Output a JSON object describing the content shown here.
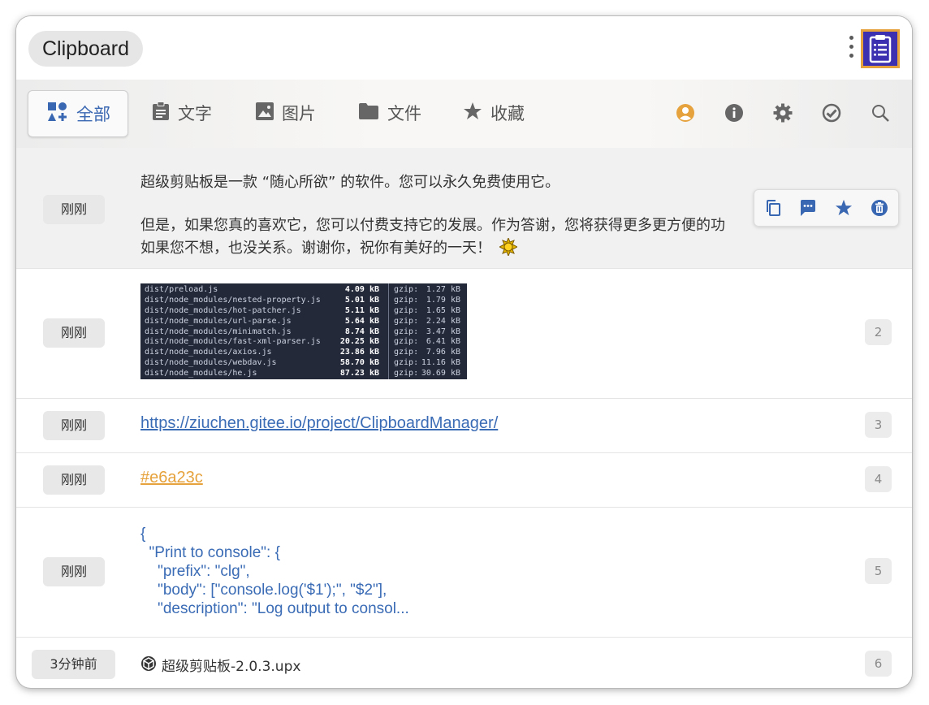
{
  "app": {
    "title": "Clipboard"
  },
  "colors": {
    "accent": "#3a67b1",
    "user_orange": "#e6a23c",
    "link_blue": "#3a6bb5"
  },
  "tabs": [
    {
      "label": "全部",
      "icon": "all-categories-icon",
      "active": true
    },
    {
      "label": "文字",
      "icon": "clipboard-text-icon",
      "active": false
    },
    {
      "label": "图片",
      "icon": "image-icon",
      "active": false
    },
    {
      "label": "文件",
      "icon": "folder-icon",
      "active": false
    },
    {
      "label": "收藏",
      "icon": "star-icon",
      "active": false
    }
  ],
  "toolbar_icons": [
    "user-icon",
    "info-icon",
    "gear-icon",
    "check-badge-icon",
    "search-icon"
  ],
  "hover_actions": [
    "copy-icon",
    "comment-icon",
    "star-icon",
    "delete-icon"
  ],
  "items": [
    {
      "time": "刚刚",
      "type": "text",
      "lines": [
        "超级剪贴板是一款 “随心所欲” 的软件。您可以永久免费使用它。",
        "但是，如果您真的喜欢它，您可以付费支持它的发展。作为答谢，您将获得更多更方便的功",
        "如果您不想，也没关系。谢谢你，祝你有美好的一天！"
      ]
    },
    {
      "time": "刚刚",
      "type": "image",
      "number": "2",
      "terminal": [
        {
          "path": "dist/preload.js",
          "size": "4.09 kB",
          "gzip": "gzip:",
          "gsize": "1.27 kB"
        },
        {
          "path": "dist/node_modules/nested-property.js",
          "size": "5.01 kB",
          "gzip": "gzip:",
          "gsize": "1.79 kB"
        },
        {
          "path": "dist/node_modules/hot-patcher.js",
          "size": "5.11 kB",
          "gzip": "gzip:",
          "gsize": "1.65 kB"
        },
        {
          "path": "dist/node_modules/url-parse.js",
          "size": "5.64 kB",
          "gzip": "gzip:",
          "gsize": "2.24 kB"
        },
        {
          "path": "dist/node_modules/minimatch.js",
          "size": "8.74 kB",
          "gzip": "gzip:",
          "gsize": "3.47 kB"
        },
        {
          "path": "dist/node_modules/fast-xml-parser.js",
          "size": "20.25 kB",
          "gzip": "gzip:",
          "gsize": "6.41 kB"
        },
        {
          "path": "dist/node_modules/axios.js",
          "size": "23.86 kB",
          "gzip": "gzip:",
          "gsize": "7.96 kB"
        },
        {
          "path": "dist/node_modules/webdav.js",
          "size": "58.70 kB",
          "gzip": "gzip:",
          "gsize": "11.16 kB"
        },
        {
          "path": "dist/node_modules/he.js",
          "size": "87.23 kB",
          "gzip": "gzip:",
          "gsize": "30.69 kB"
        }
      ]
    },
    {
      "time": "刚刚",
      "type": "link",
      "number": "3",
      "text": "https://ziuchen.gitee.io/project/ClipboardManager/"
    },
    {
      "time": "刚刚",
      "type": "color",
      "number": "4",
      "text": "#e6a23c"
    },
    {
      "time": "刚刚",
      "type": "code",
      "number": "5",
      "lines": [
        "{",
        "  \"Print to console\": {",
        "    \"prefix\": \"clg\",",
        "    \"body\": [\"console.log('$1');\", \"$2\"],",
        "    \"description\": \"Log output to consol..."
      ]
    },
    {
      "time": "3分钟前",
      "type": "file",
      "number": "6",
      "text": "超级剪贴板-2.0.3.upx",
      "icon": "upx-package-icon"
    }
  ]
}
